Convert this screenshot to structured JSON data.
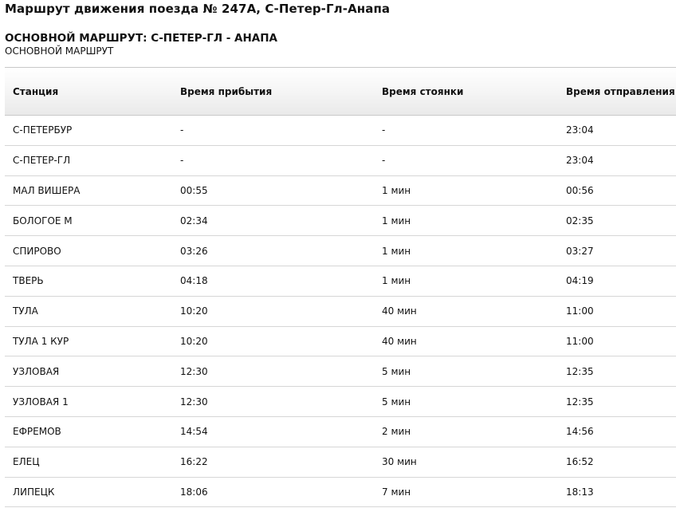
{
  "page_title": "Маршрут движения поезда № 247А, С-Петер-Гл-Анапа",
  "route": {
    "heading": "ОСНОВНОЙ МАРШРУТ: С-ПЕТЕР-ГЛ - АНАПА",
    "subheading": "ОСНОВНОЙ МАРШРУТ"
  },
  "table": {
    "headers": {
      "station": "Станция",
      "arrival": "Время прибытия",
      "stop": "Время стоянки",
      "departure": "Время отправления"
    },
    "rows": [
      {
        "station": "С-ПЕТЕРБУР",
        "arrival": "-",
        "stop": "-",
        "departure": "23:04"
      },
      {
        "station": "С-ПЕТЕР-ГЛ",
        "arrival": "-",
        "stop": "-",
        "departure": "23:04"
      },
      {
        "station": "МАЛ ВИШЕРА",
        "arrival": "00:55",
        "stop": "1 мин",
        "departure": "00:56"
      },
      {
        "station": "БОЛОГОЕ М",
        "arrival": "02:34",
        "stop": "1 мин",
        "departure": "02:35"
      },
      {
        "station": "СПИРОВО",
        "arrival": "03:26",
        "stop": "1 мин",
        "departure": "03:27"
      },
      {
        "station": "ТВЕРЬ",
        "arrival": "04:18",
        "stop": "1 мин",
        "departure": "04:19"
      },
      {
        "station": "ТУЛА",
        "arrival": "10:20",
        "stop": "40 мин",
        "departure": "11:00"
      },
      {
        "station": "ТУЛА 1 КУР",
        "arrival": "10:20",
        "stop": "40 мин",
        "departure": "11:00"
      },
      {
        "station": "УЗЛОВАЯ",
        "arrival": "12:30",
        "stop": "5 мин",
        "departure": "12:35"
      },
      {
        "station": "УЗЛОВАЯ 1",
        "arrival": "12:30",
        "stop": "5 мин",
        "departure": "12:35"
      },
      {
        "station": "ЕФРЕМОВ",
        "arrival": "14:54",
        "stop": "2 мин",
        "departure": "14:56"
      },
      {
        "station": "ЕЛЕЦ",
        "arrival": "16:22",
        "stop": "30 мин",
        "departure": "16:52"
      },
      {
        "station": "ЛИПЕЦК",
        "arrival": "18:06",
        "stop": "7 мин",
        "departure": "18:13"
      }
    ]
  }
}
